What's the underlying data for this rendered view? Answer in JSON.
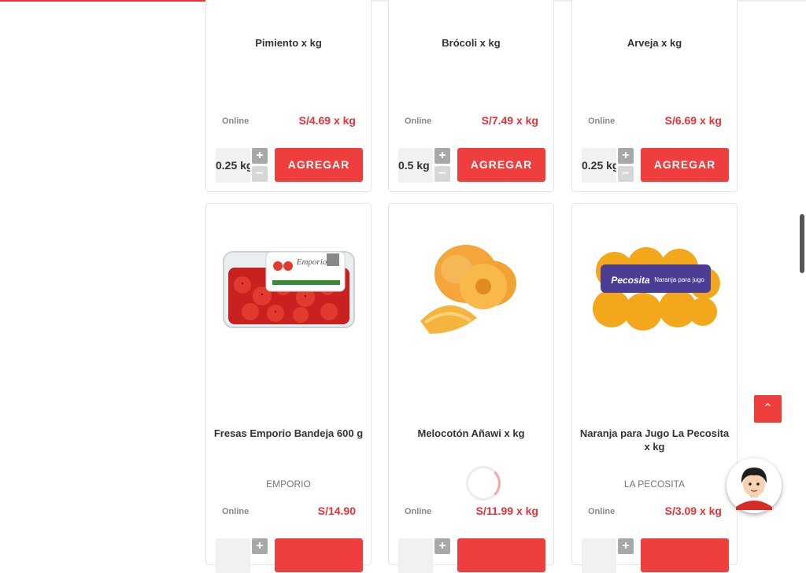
{
  "top_row": [
    {
      "name": "Pimiento x kg",
      "brand": "",
      "channel": "Online",
      "price": "S/4.69 x kg",
      "qty": "0.25 kg",
      "plus": "+",
      "minus": "−",
      "button": "AGREGAR"
    },
    {
      "name": "Brócoli x kg",
      "brand": "",
      "channel": "Online",
      "price": "S/7.49 x kg",
      "qty": "0.5 kg",
      "plus": "+",
      "minus": "−",
      "button": "AGREGAR"
    },
    {
      "name": "Arveja x kg",
      "brand": "",
      "channel": "Online",
      "price": "S/6.69 x kg",
      "qty": "0.25 kg",
      "plus": "+",
      "minus": "−",
      "button": "AGREGAR"
    }
  ],
  "bottom_row": [
    {
      "name": "Fresas Emporio Bandeja 600 g",
      "brand": "EMPORIO",
      "channel": "Online",
      "price": "S/14.90",
      "plus": "+"
    },
    {
      "name": "Melocotón Añawi x kg",
      "brand": "",
      "channel": "Online",
      "price": "S/11.99 x kg",
      "plus": "+"
    },
    {
      "name": "Naranja para Jugo La Pecosita x kg",
      "brand": "LA PECOSITA",
      "channel": "Online",
      "price": "S/3.09 x kg",
      "plus": "+"
    }
  ],
  "image_labels": {
    "fresas_brand": "Emporio",
    "naranja_logo": "Pecosita",
    "naranja_tag": "Naranja para jugo"
  },
  "scroll_top": {
    "icon": "chevron-up-icon",
    "glyph": "⌃"
  },
  "chat": {
    "icon": "assistant-avatar-icon"
  },
  "colors": {
    "accent": "#ef3e3e",
    "price": "#e8313b",
    "muted": "#888888"
  }
}
